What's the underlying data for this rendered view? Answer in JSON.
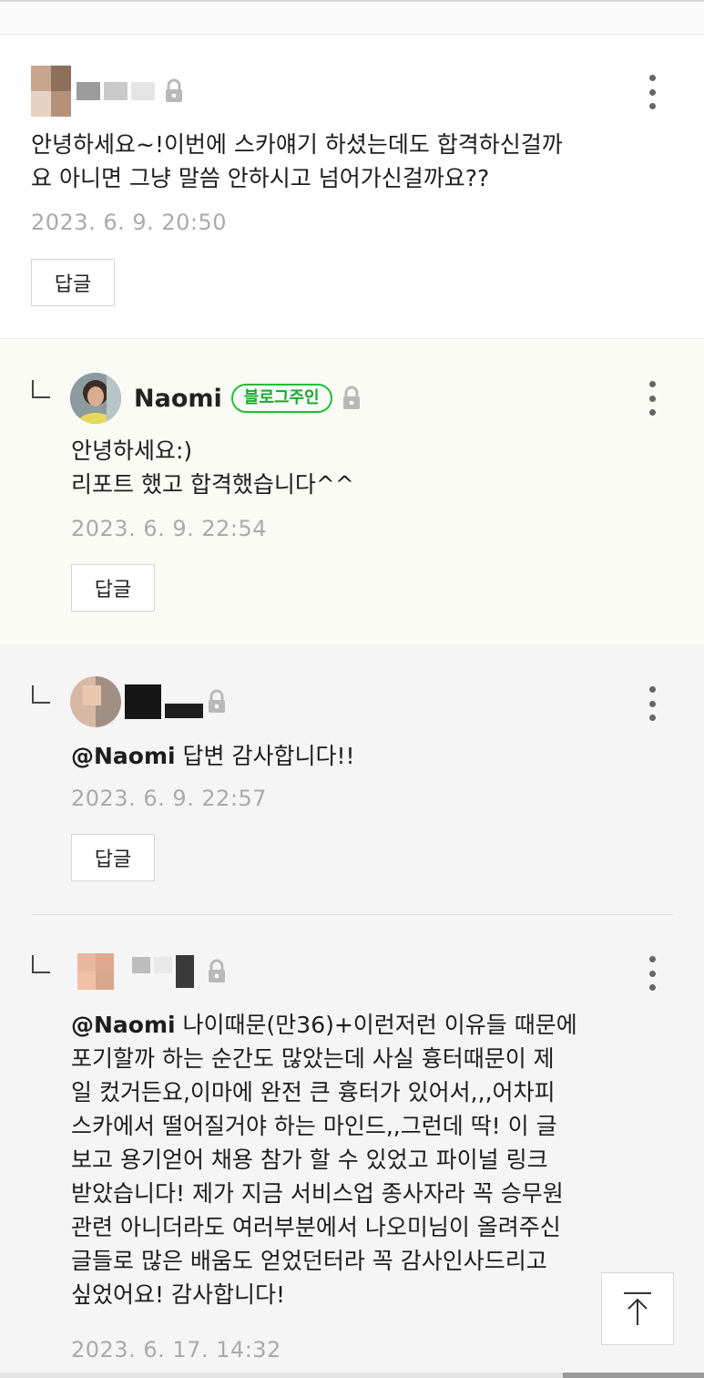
{
  "comments": [
    {
      "text": "안녕하세요~!이번에 스카얘기 하셨는데도 합격하신걸까\n요 아니면 그냥 말씀 안하시고 넘어가신걸까요??",
      "timestamp": "2023. 6. 9. 20:50",
      "reply_label": "답글"
    },
    {
      "author": "Naomi",
      "badge": "블로그주인",
      "text": "안녕하세요:)\n리포트 했고 합격했습니다^^",
      "timestamp": "2023. 6. 9. 22:54",
      "reply_label": "답글"
    },
    {
      "mention": "@Naomi",
      "text": " 답변 감사합니다!!",
      "timestamp": "2023. 6. 9. 22:57",
      "reply_label": "답글"
    },
    {
      "mention": "@Naomi",
      "text": " 나이때문(만36)+이런저런 이유들 때문에\n포기할까 하는 순간도 많았는데 사실 흉터때문이 제\n일 컸거든요,이마에 완전 큰 흉터가 있어서,,,어차피\n스카에서 떨어질거야 하는 마인드,,그런데 딱! 이 글\n보고 용기얻어 채용 참가 할 수 있었고 파이널 링크\n받았습니다! 제가 지금 서비스업 종사자라 꼭 승무원\n관련 아니더라도 여러부분에서 나오미님이 올려주신\n글들로 많은 배움도 얻었던터라 꼭 감사인사드리고\n싶었어요! 감사합니다!",
      "timestamp": "2023. 6. 17. 14:32"
    }
  ],
  "icons": {
    "lock": "lock-icon",
    "more": "more-vertical-icon",
    "reply": "reply-arrow-icon",
    "scroll_top": "arrow-up-icon"
  },
  "colors": {
    "badge_green": "#1fbe3a",
    "owner_reply_bg": "#f9fbf4",
    "nested_bg": "#f5f5f5",
    "timestamp_gray": "#aaaaaa"
  }
}
